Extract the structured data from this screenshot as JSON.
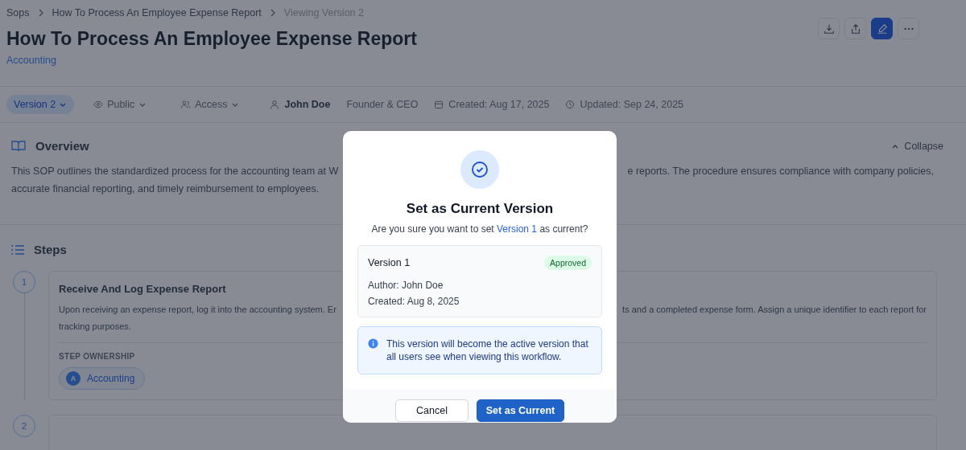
{
  "breadcrumb": [
    {
      "label": "Sops"
    },
    {
      "label": "How To Process An Employee Expense Report"
    },
    {
      "label": "Viewing Version 2"
    }
  ],
  "title": "How To Process An Employee Expense Report",
  "category": "Accounting",
  "meta": {
    "version": "Version 2",
    "visibility": "Public",
    "access": "Access",
    "author": "John Doe",
    "role": "Founder & CEO",
    "created": "Created: Aug 17, 2025",
    "updated": "Updated: Sep 24, 2025"
  },
  "overview": {
    "title": "Overview",
    "collapse": "Collapse",
    "text_left": "This SOP outlines the standardized process for the accounting team at W",
    "text_right": "e reports. The procedure ensures compliance with company policies,",
    "text_line_2": "accurate financial reporting, and timely reimbursement to employees."
  },
  "steps": {
    "title": "Steps",
    "items": [
      {
        "number": "1",
        "title": "Receive And Log Expense Report",
        "text_left": "Upon receiving an expense report, log it into the accounting system. Er",
        "text_right": "ts and a completed expense form. Assign a unique identifier to each report for",
        "text_line_2": "tracking purposes.",
        "ownership_label": "STEP OWNERSHIP",
        "owners": [
          {
            "initial": "A",
            "name": "Accounting"
          }
        ]
      },
      {
        "number": "2"
      }
    ]
  },
  "dialog": {
    "title": "Set as Current Version",
    "prompt_before": "Are you sure you want to set",
    "prompt_link": "Version 1",
    "prompt_after": "as current?",
    "version": {
      "name": "Version 1",
      "status": "Approved",
      "author": "Author: John Doe",
      "created": "Created: Aug 8, 2025"
    },
    "info": "This version will become the active version that all users see when viewing this workflow.",
    "cancel": "Cancel",
    "confirm": "Set as Current"
  }
}
